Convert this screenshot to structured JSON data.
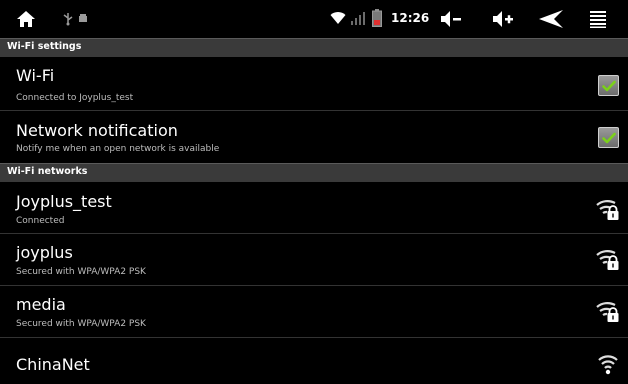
{
  "status_bar": {
    "time": "12:26",
    "icons": [
      "home-icon",
      "usb-icon",
      "android-debug-icon",
      "wifi-signal-icon",
      "cell-signal-icon",
      "battery-icon",
      "volume-down-icon",
      "volume-up-icon",
      "back-icon",
      "menu-icon"
    ]
  },
  "sections": {
    "wifi_settings": "Wi-Fi settings",
    "wifi_networks": "Wi-Fi networks"
  },
  "settings": [
    {
      "title": "Wi-Fi",
      "subtitle": "Connected to Joyplus_test",
      "checked": true
    },
    {
      "title": "Network notification",
      "subtitle": "Notify me when an open network is available",
      "checked": true
    }
  ],
  "networks": [
    {
      "ssid": "Joyplus_test",
      "status": "Connected",
      "secured": true
    },
    {
      "ssid": "joyplus",
      "status": "Secured with WPA/WPA2 PSK",
      "secured": true
    },
    {
      "ssid": "media",
      "status": "Secured with WPA/WPA2 PSK",
      "secured": true
    },
    {
      "ssid": "ChinaNet",
      "status": "",
      "secured": false
    }
  ],
  "colors": {
    "check_green": "#7bd11a",
    "header_bg": "#3a3a3a"
  }
}
